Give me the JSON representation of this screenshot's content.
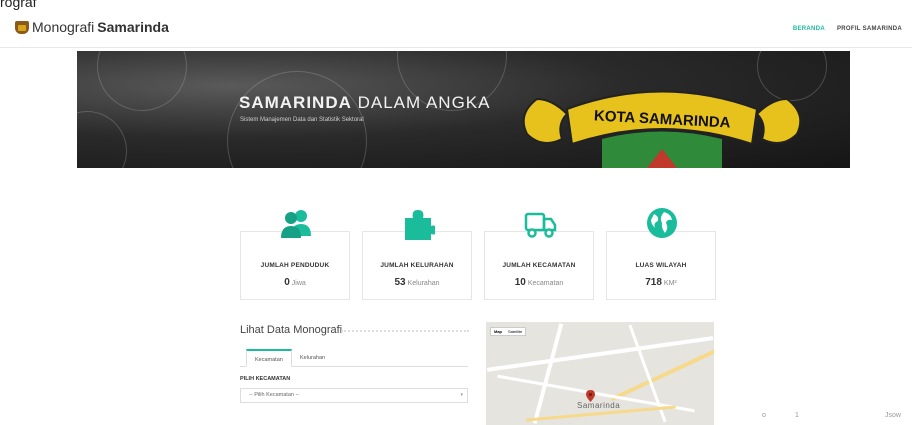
{
  "fragment_top": "rograf",
  "brand": {
    "name_plain": "Monografi",
    "name_bold": "Samarinda"
  },
  "nav": {
    "home": "BERANDA",
    "profile": "PROFIL SAMARINDA"
  },
  "banner": {
    "title_bold": "SAMARINDA",
    "title_rest": " DALAM ANGKA",
    "subtitle": "Sistem Manajemen Data dan Statistik Sektoral",
    "emblem_text": "KOTA SAMARINDA"
  },
  "stats": [
    {
      "label": "JUMLAH PENDUDUK",
      "value": "0",
      "unit": "Jiwa",
      "icon": "users-icon"
    },
    {
      "label": "JUMLAH KELURAHAN",
      "value": "53",
      "unit": "Kelurahan",
      "icon": "puzzle-icon"
    },
    {
      "label": "JUMLAH KECAMATAN",
      "value": "10",
      "unit": "Kecamatan",
      "icon": "truck-icon"
    },
    {
      "label": "LUAS WILAYAH",
      "value": "718",
      "unit": "KM²",
      "icon": "globe-icon"
    }
  ],
  "monografi": {
    "title": "Lihat Data Monografi",
    "tabs": [
      "Kecamatan",
      "Kelurahan"
    ],
    "select_label": "PILIH KECAMATAN",
    "select_value": "-- Pilih Kecamatan --"
  },
  "map": {
    "toggle": [
      "Map",
      "Satellite"
    ],
    "city": "Samarinda"
  },
  "footer_fragments": [
    "o",
    "1",
    "Jsow"
  ],
  "colors": {
    "accent": "#1abc9c",
    "pin": "#c0392b"
  }
}
